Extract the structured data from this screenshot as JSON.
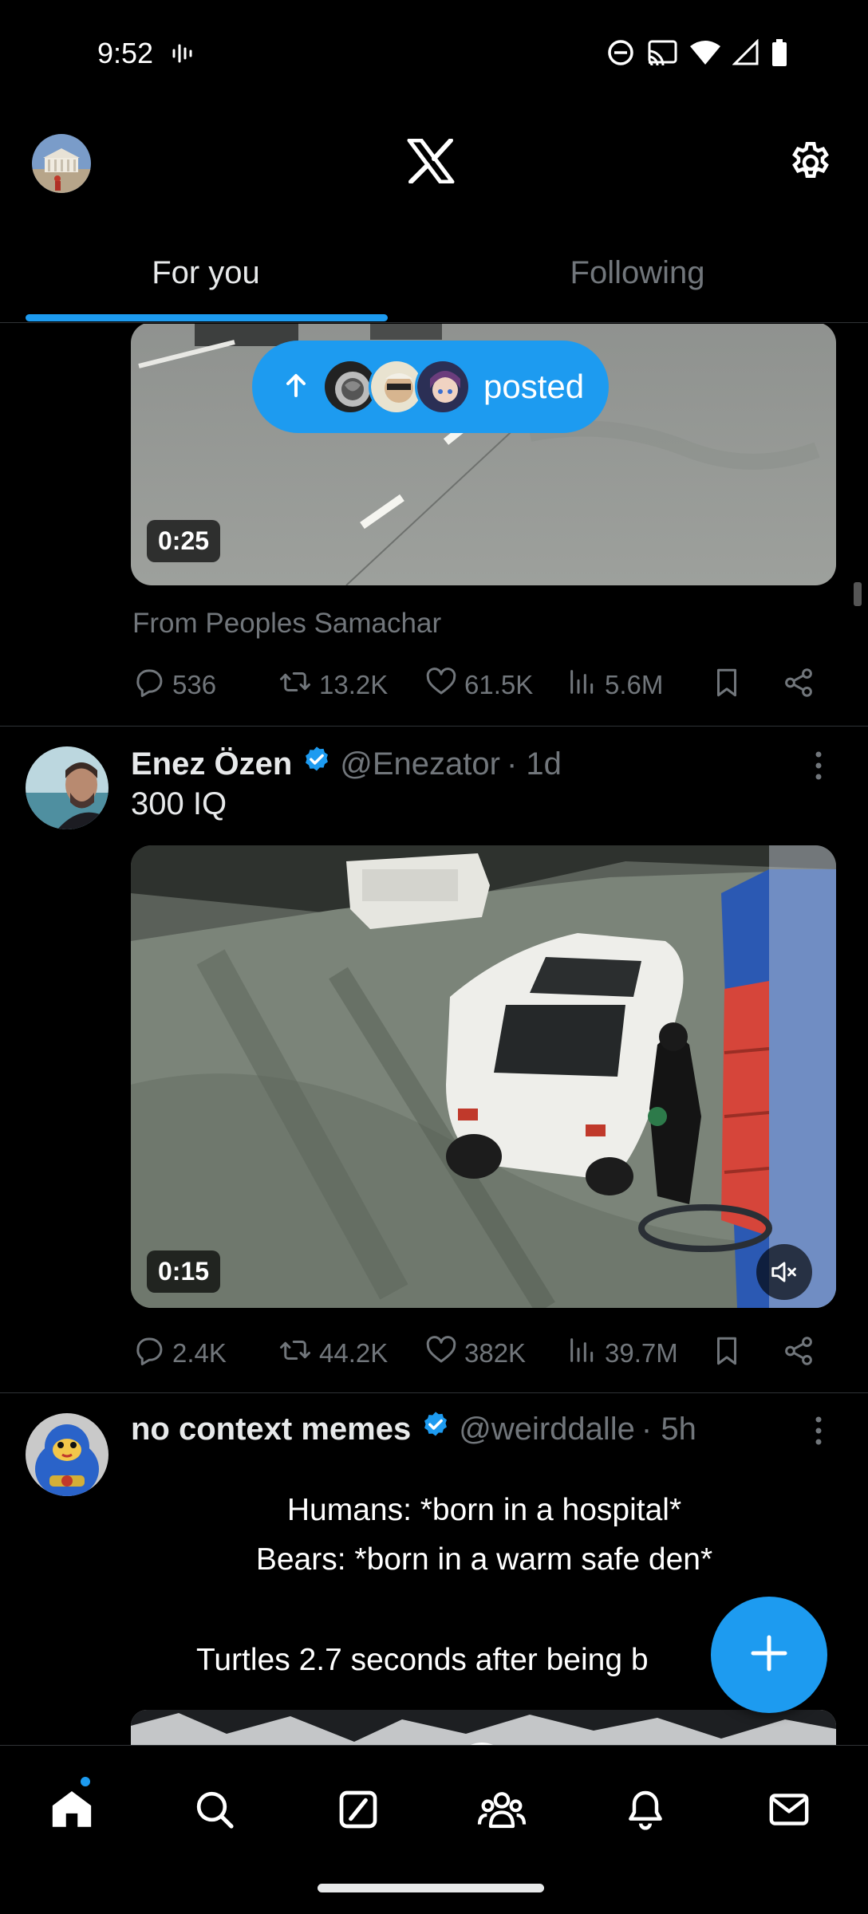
{
  "status_bar": {
    "time": "9:52"
  },
  "header": {
    "logo": "x-logo"
  },
  "tabs": [
    {
      "label": "For you",
      "active": true
    },
    {
      "label": "Following",
      "active": false
    }
  ],
  "posted_pill": {
    "label": "posted"
  },
  "posts": [
    {
      "media_duration": "0:25",
      "source": "From Peoples Samachar",
      "stats": {
        "replies": "536",
        "reposts": "13.2K",
        "likes": "61.5K",
        "views": "5.6M"
      }
    },
    {
      "name": "Enez Özen",
      "handle": "@Enezator",
      "time": "· 1d",
      "verified": true,
      "text": "300 IQ",
      "media_duration": "0:15",
      "stats": {
        "replies": "2.4K",
        "reposts": "44.2K",
        "likes": "382K",
        "views": "39.7M"
      }
    },
    {
      "name": "no context memes",
      "handle": "@weirddalle",
      "time": "· 5h",
      "verified": true,
      "meme_lines": [
        "Humans: *born in a hospital*",
        "Bears: *born in a warm safe den*",
        "Turtles 2.7 seconds after being b"
      ]
    }
  ],
  "colors": {
    "accent": "#1d9bf0",
    "background": "#000000",
    "secondary_text": "#71767b",
    "divider": "#2f3336"
  },
  "icons": [
    "soundwave-icon",
    "dnd-icon",
    "cast-icon",
    "wifi-icon",
    "signal-icon",
    "battery-icon",
    "settings-icon",
    "reply-icon",
    "repost-icon",
    "like-icon",
    "views-icon",
    "bookmark-icon",
    "share-icon",
    "more-icon",
    "verified-icon",
    "mute-icon",
    "compose-icon",
    "home-icon",
    "search-icon",
    "grok-icon",
    "communities-icon",
    "notifications-icon",
    "messages-icon"
  ]
}
